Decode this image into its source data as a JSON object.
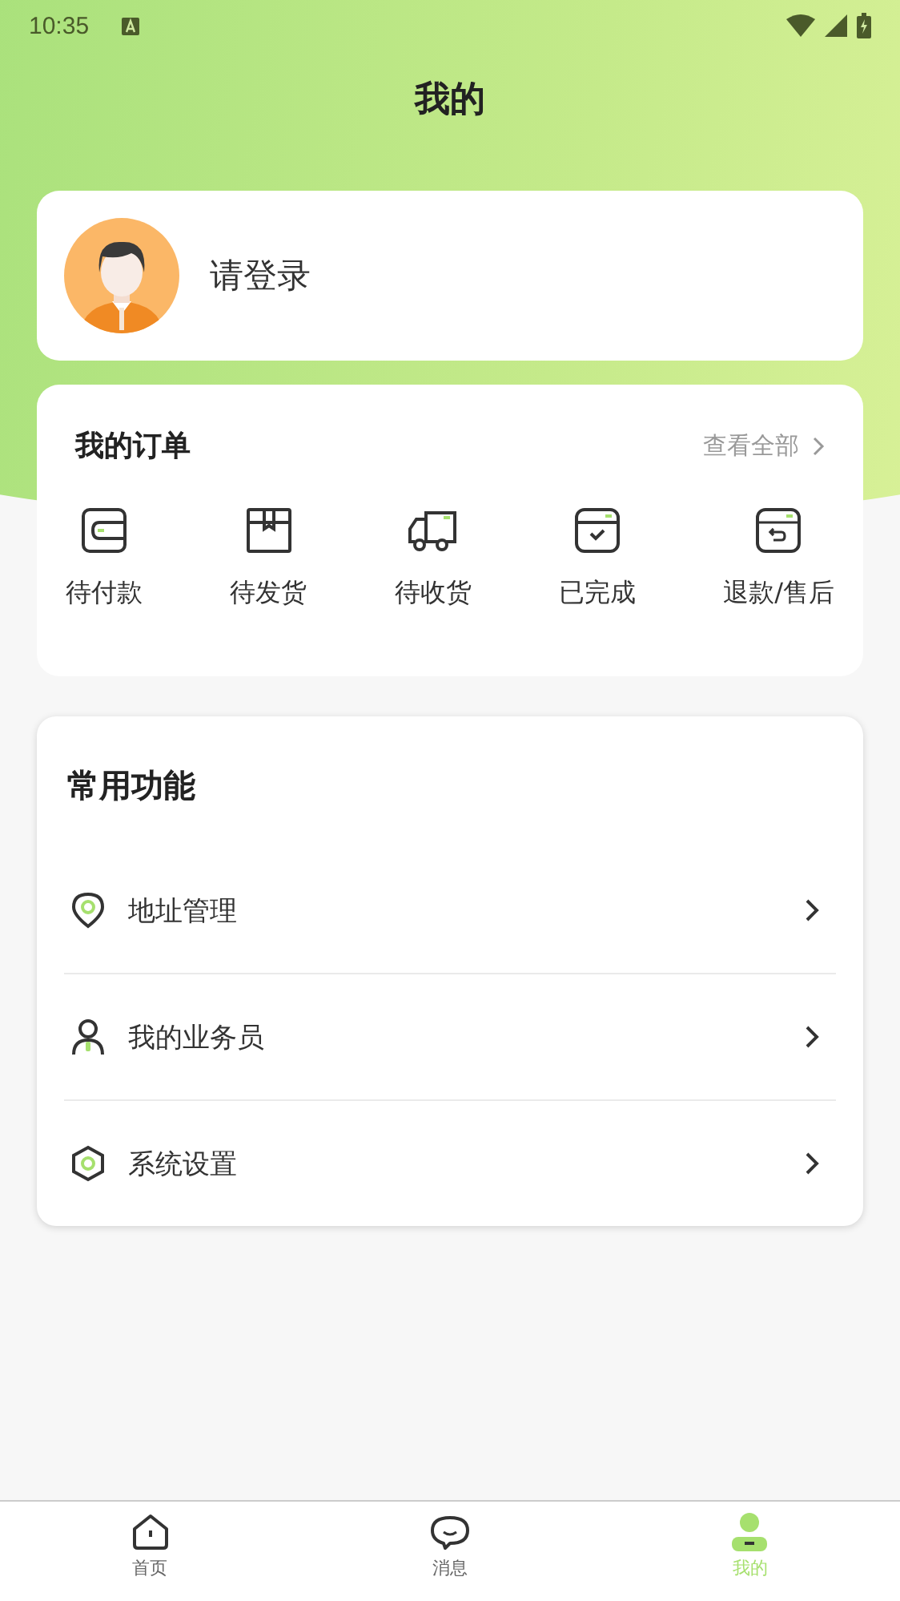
{
  "status_bar": {
    "time": "10:35"
  },
  "title": "我的",
  "profile": {
    "login_prompt": "请登录"
  },
  "orders": {
    "title": "我的订单",
    "view_all": "查看全部",
    "items": [
      {
        "label": "待付款"
      },
      {
        "label": "待发货"
      },
      {
        "label": "待收货"
      },
      {
        "label": "已完成"
      },
      {
        "label": "退款/售后"
      }
    ]
  },
  "functions": {
    "title": "常用功能",
    "items": [
      {
        "label": "地址管理"
      },
      {
        "label": "我的业务员"
      },
      {
        "label": "系统设置"
      }
    ]
  },
  "tab_bar": [
    {
      "label": "首页",
      "selected": false
    },
    {
      "label": "消息",
      "selected": false
    },
    {
      "label": "我的",
      "selected": true
    }
  ]
}
